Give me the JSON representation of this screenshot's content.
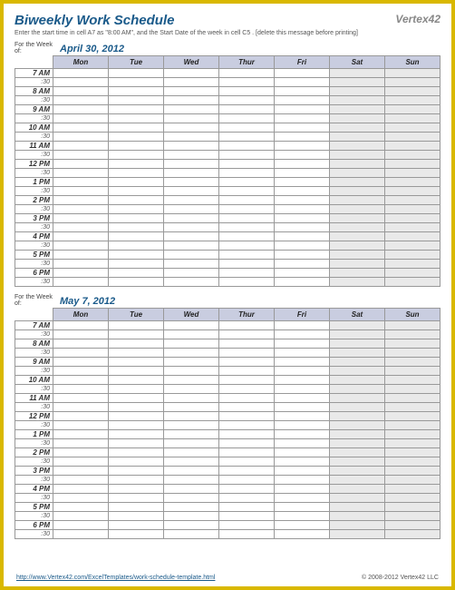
{
  "header": {
    "title": "Biweekly Work Schedule",
    "logo": "Vertex42",
    "instructions": "Enter the start time in cell A7 as \"8:00 AM\", and the Start Date of the week in cell C5 . [delete this message before printing]"
  },
  "labels": {
    "for_week": "For the Week of:",
    "half_hour": ":30"
  },
  "days": [
    "Mon",
    "Tue",
    "Wed",
    "Thur",
    "Fri",
    "Sat",
    "Sun"
  ],
  "weekend_indices": [
    5,
    6
  ],
  "times": [
    "7 AM",
    "8 AM",
    "9 AM",
    "10 AM",
    "11 AM",
    "12 PM",
    "1 PM",
    "2 PM",
    "3 PM",
    "4 PM",
    "5 PM",
    "6 PM"
  ],
  "weeks": [
    {
      "date": "April 30, 2012"
    },
    {
      "date": "May 7, 2012"
    }
  ],
  "footer": {
    "link_text": "http://www.Vertex42.com/ExcelTemplates/work-schedule-template.html",
    "copyright": "© 2008-2012 Vertex42 LLC"
  }
}
